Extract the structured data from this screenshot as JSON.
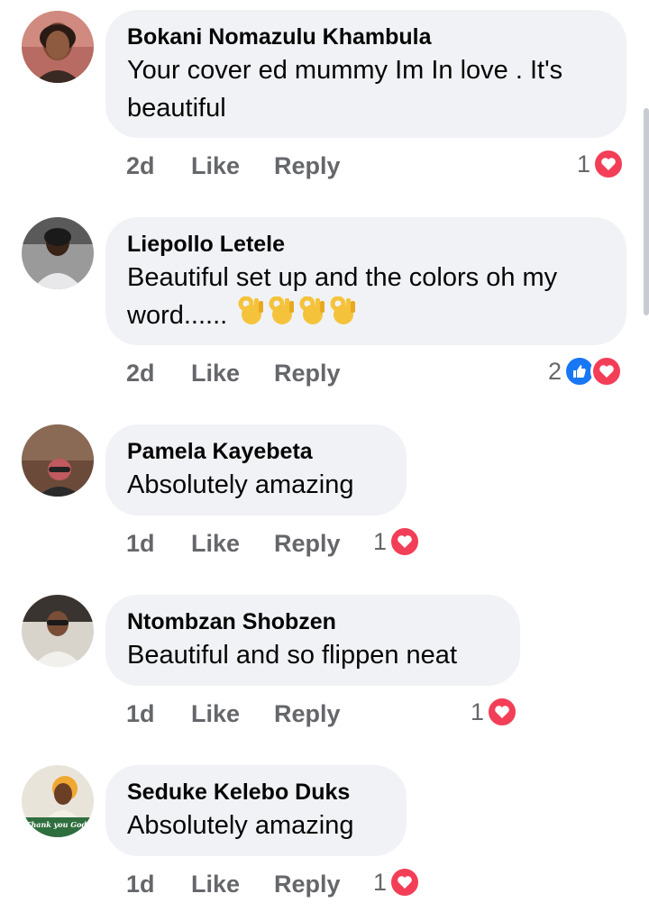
{
  "comments": [
    {
      "name": "Bokani Nomazulu Khambula",
      "text_line1": "Your cover ed mummy Im In love . It's",
      "text_line2": "beautiful",
      "time": "2d",
      "like": "Like",
      "reply": "Reply",
      "reaction_count": "1",
      "reactions": [
        "heart-icon"
      ]
    },
    {
      "name": "Liepollo Letele",
      "text_line1": "Beautiful set up and the colors oh my",
      "text_line2": "word......",
      "emojis": [
        "ok-hand-emoji",
        "ok-hand-emoji",
        "ok-hand-emoji",
        "ok-hand-emoji"
      ],
      "time": "2d",
      "like": "Like",
      "reply": "Reply",
      "reaction_count": "2",
      "reactions": [
        "like-icon",
        "heart-icon"
      ]
    },
    {
      "name": "Pamela Kayebeta",
      "text_line1": "Absolutely amazing",
      "time": "1d",
      "like": "Like",
      "reply": "Reply",
      "reaction_count": "1",
      "reactions": [
        "heart-icon"
      ]
    },
    {
      "name": "Ntombzan Shobzen",
      "text_line1": "Beautiful and so flippen neat",
      "time": "1d",
      "like": "Like",
      "reply": "Reply",
      "reaction_count": "1",
      "reactions": [
        "heart-icon"
      ]
    },
    {
      "name": "Seduke Kelebo Duks",
      "text_line1": "Absolutely amazing",
      "time": "1d",
      "like": "Like",
      "reply": "Reply",
      "reaction_count": "1",
      "reactions": [
        "heart-icon"
      ],
      "avatar_caption": "Thank you God!"
    }
  ],
  "colors": {
    "bubble": "#f0f2f5",
    "meta_text": "#65676b",
    "heart": "#f33e58",
    "like": "#1877f2"
  }
}
